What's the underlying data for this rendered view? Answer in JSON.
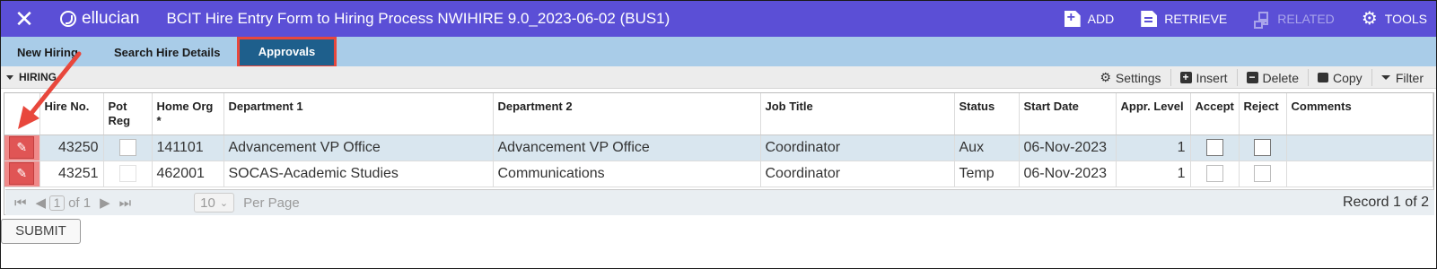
{
  "app": {
    "close_glyph": "✕",
    "brand": "ellucian",
    "title": "BCIT Hire Entry Form to Hiring Process NWIHIRE 9.0_2023-06-02 (BUS1)"
  },
  "toolbar": {
    "add": "ADD",
    "retrieve": "RETRIEVE",
    "related": "RELATED",
    "tools": "TOOLS"
  },
  "tabs": [
    {
      "label": "New Hiring"
    },
    {
      "label": "Search Hire Details"
    },
    {
      "label": "Approvals"
    }
  ],
  "section": {
    "title": "HIRING",
    "settings": "Settings",
    "insert": "Insert",
    "delete": "Delete",
    "copy": "Copy",
    "filter": "Filter"
  },
  "grid": {
    "headers": [
      "Hire No.",
      "Pot Reg",
      "Home Org *",
      "Department 1",
      "Department 2",
      "Job Title",
      "Status",
      "Start Date",
      "Appr. Level",
      "Accept",
      "Reject",
      "Comments"
    ],
    "rows": [
      {
        "hire_no": "43250",
        "home_org": "141101",
        "dept1": "Advancement VP Office",
        "dept2": "Advancement VP Office",
        "job_title": "Coordinator",
        "status": "Aux",
        "start_date": "06-Nov-2023",
        "appr_level": "1"
      },
      {
        "hire_no": "43251",
        "home_org": "462001",
        "dept1": "SOCAS-Academic Studies",
        "dept2": "Communications",
        "job_title": "Coordinator",
        "status": "Temp",
        "start_date": "06-Nov-2023",
        "appr_level": "1"
      }
    ]
  },
  "pager": {
    "page": "1",
    "of": "of 1",
    "per_page_value": "10",
    "per_page_label": "Per Page",
    "record": "Record 1 of 2"
  },
  "submit_label": "SUBMIT",
  "colors": {
    "header_bg": "#5b4fd6",
    "tab_bar": "#a9cce8",
    "tab_active": "#1e5f8c",
    "highlight": "#e8473c"
  }
}
